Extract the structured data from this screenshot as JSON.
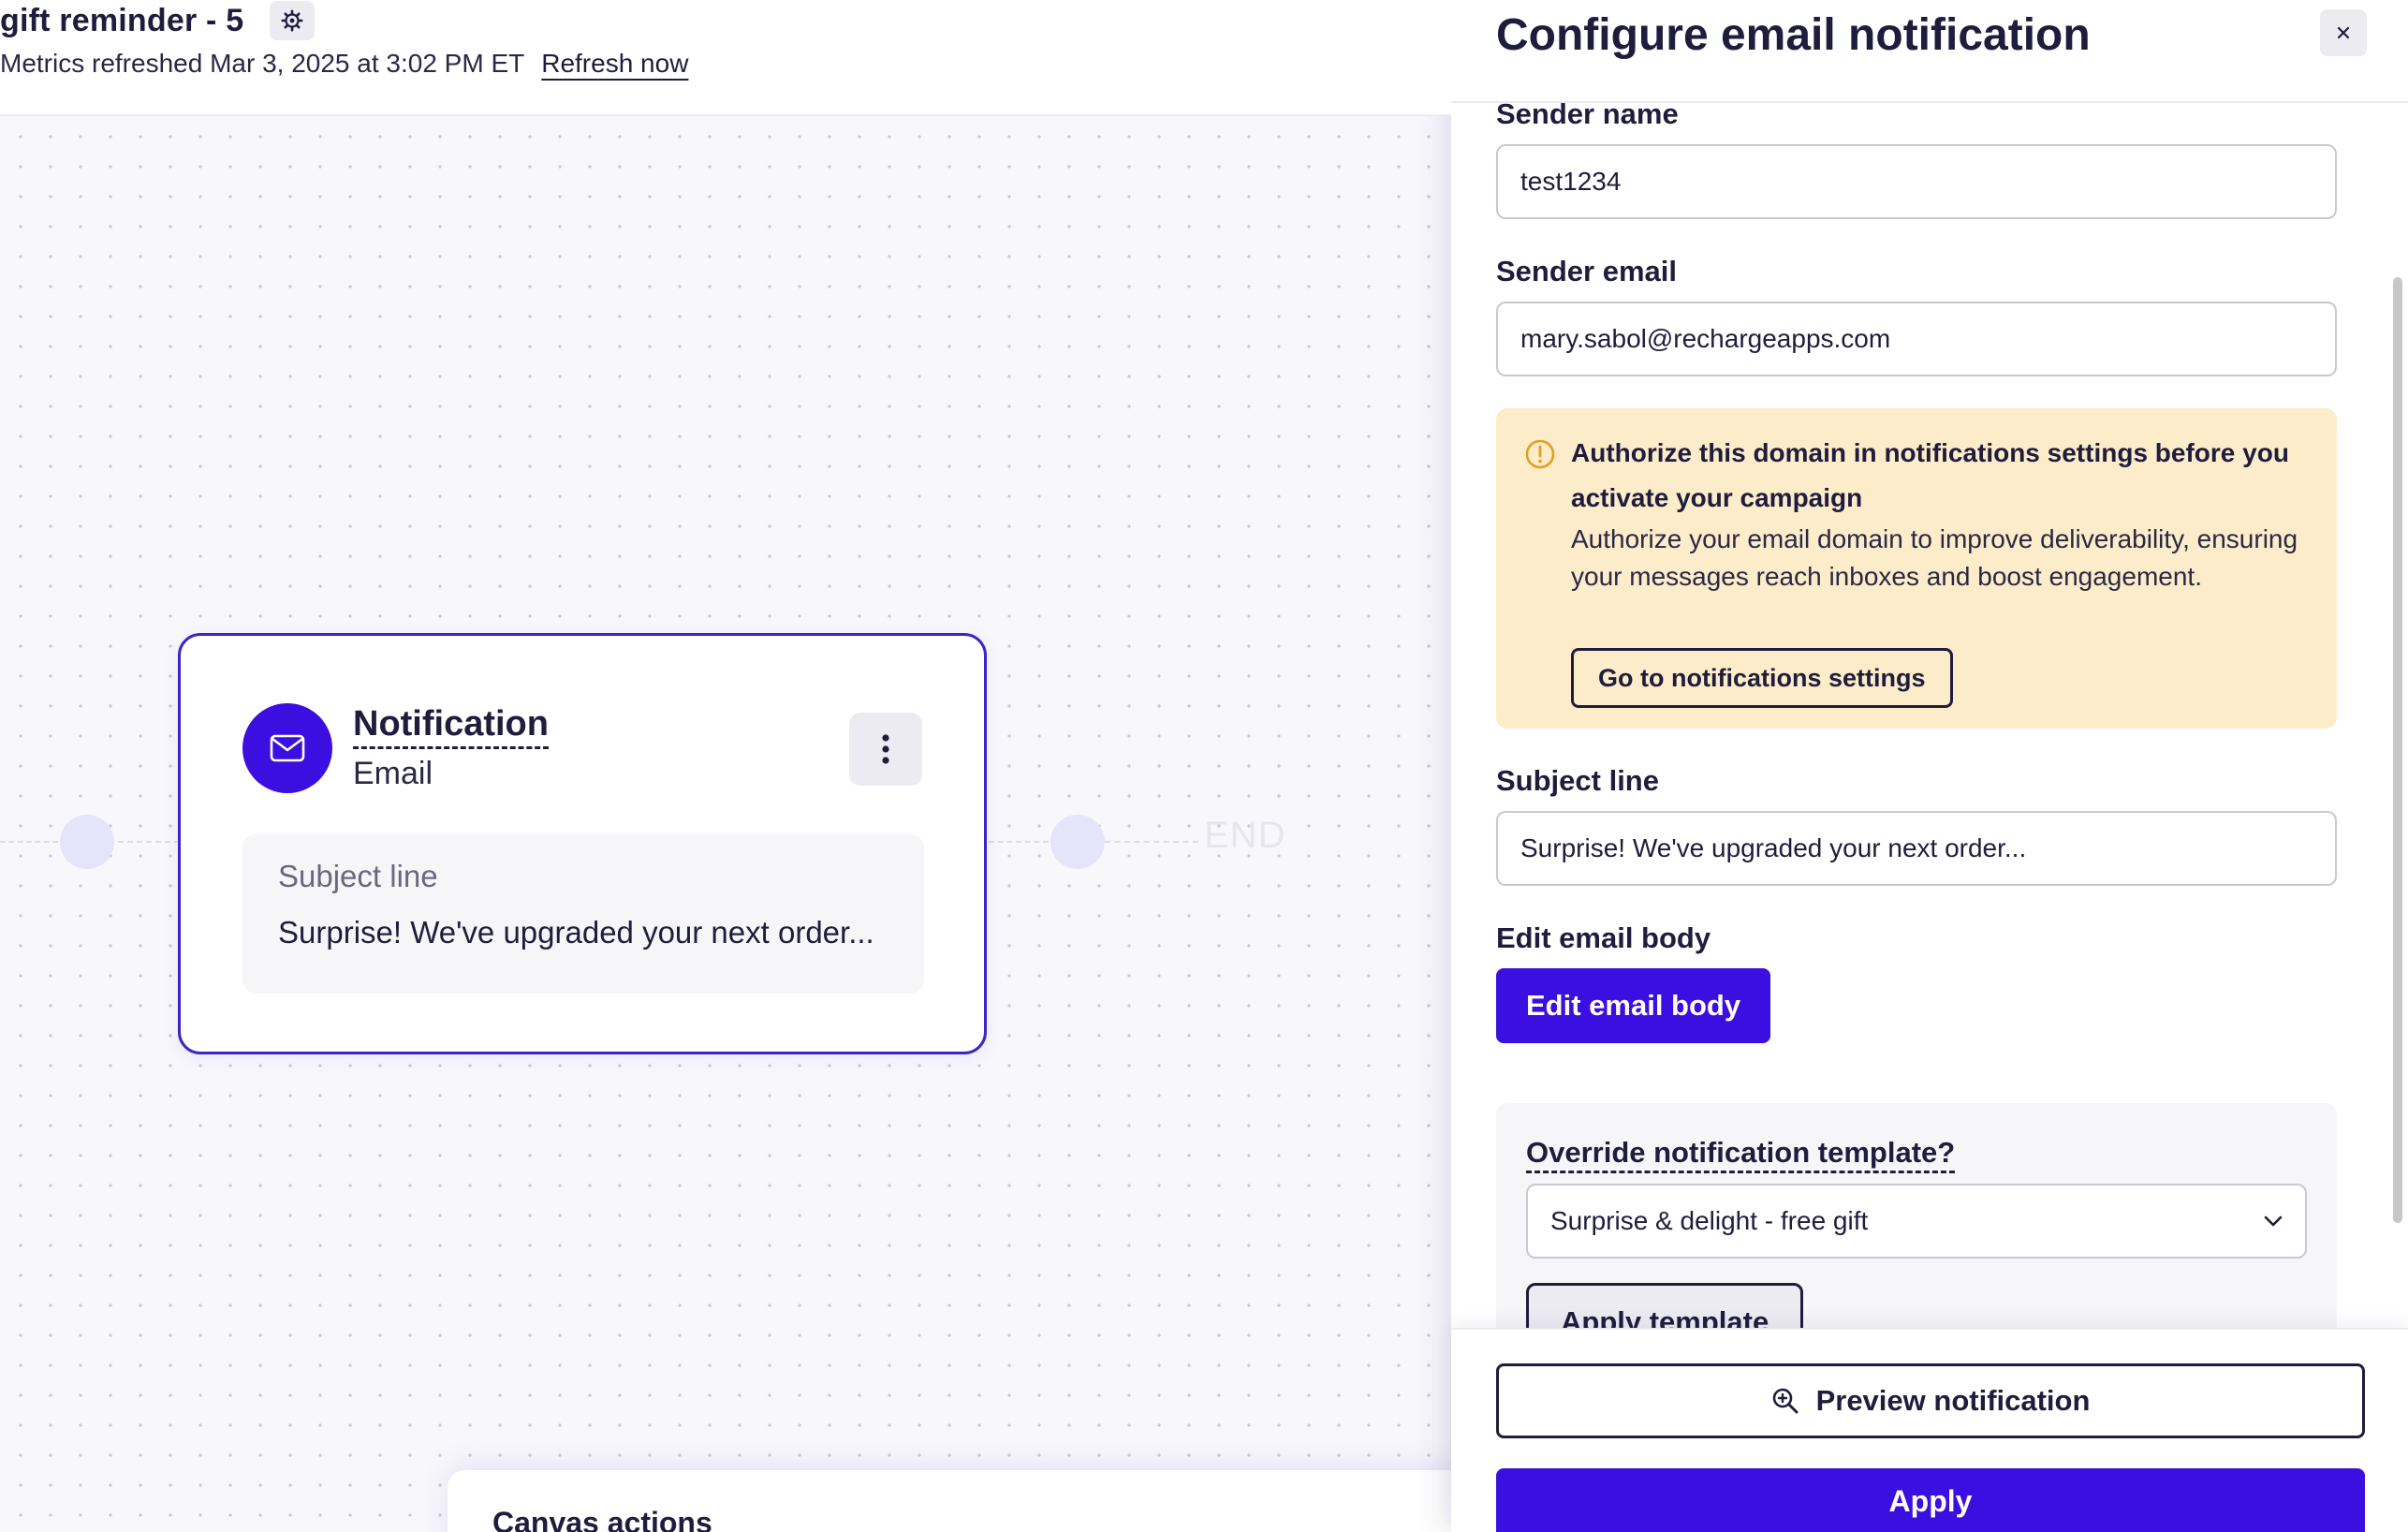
{
  "header": {
    "title": "gift reminder - 5",
    "metrics_text": "Metrics refreshed Mar 3, 2025 at 3:02 PM ET",
    "refresh_label": "Refresh now"
  },
  "canvas": {
    "end_label": "END",
    "node": {
      "title": "Notification",
      "subtitle": "Email",
      "preview_label": "Subject line",
      "preview_text": "Surprise! We've upgraded your next order..."
    },
    "actions_title": "Canvas actions"
  },
  "panel": {
    "title": "Configure email notification",
    "sender_name": {
      "label": "Sender name",
      "value": "test1234"
    },
    "sender_email": {
      "label": "Sender email",
      "value": "mary.sabol@rechargeapps.com"
    },
    "alert": {
      "title": "Authorize this domain in notifications settings before you activate your campaign",
      "text": "Authorize your email domain to improve deliverability, ensuring your messages reach inboxes and boost engagement.",
      "button": "Go to notifications settings"
    },
    "subject": {
      "label": "Subject line",
      "value": "Surprise! We've upgraded your next order..."
    },
    "email_body": {
      "label": "Edit email body",
      "button": "Edit email body"
    },
    "override": {
      "label": "Override notification template?",
      "selected": "Surprise & delight - free gift",
      "apply_button": "Apply template"
    },
    "footer": {
      "preview_button": "Preview notification",
      "apply_button": "Apply"
    }
  },
  "colors": {
    "brand": "#3b0fe0",
    "text": "#1f1d3d",
    "alert_bg": "#fcecc9",
    "alert_icon": "#e0a020",
    "canvas_bg": "#f8f7fc"
  },
  "icons": {
    "settings": "gear-icon",
    "close": "close-icon",
    "node": "mail-icon",
    "menu": "kebab-icon",
    "alert": "warning-circle-icon",
    "dropdown": "chevron-down-icon",
    "preview": "zoom-icon"
  }
}
